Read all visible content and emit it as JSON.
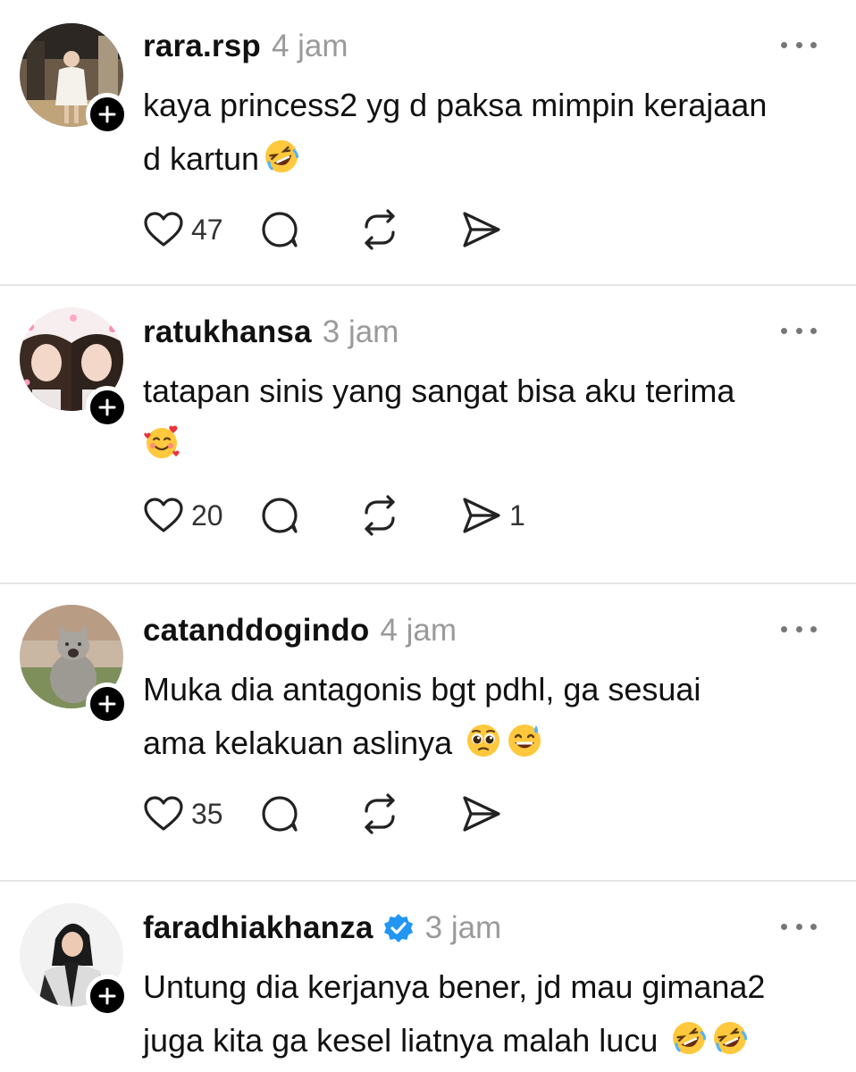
{
  "posts": [
    {
      "username": "rara.rsp",
      "time": "4 jam",
      "text_line1": "kaya princess2 yg d paksa mimpin kerajaan",
      "text_line2": "d kartun",
      "emojis": [
        "rolling-on-floor-laughing"
      ],
      "likes": "47",
      "shares": ""
    },
    {
      "username": "ratukhansa",
      "time": "3 jam",
      "text_line1": "tatapan sinis yang sangat bisa aku terima",
      "text_line2": "",
      "emojis": [
        "smiling-face-with-hearts"
      ],
      "likes": "20",
      "shares": "1"
    },
    {
      "username": "catanddogindo",
      "time": "4 jam",
      "text_line1": "Muka dia antagonis bgt pdhl, ga sesuai",
      "text_line2": "ama kelakuan aslinya ",
      "emojis": [
        "pleading-face",
        "grinning-face-with-sweat"
      ],
      "likes": "35",
      "shares": ""
    },
    {
      "username": "faradhiakhanza",
      "verified": true,
      "time": "3 jam",
      "text_line1": "Untung dia kerjanya bener, jd mau gimana2",
      "text_line2": "juga kita ga kesel liatnya malah lucu ",
      "emojis": [
        "rolling-on-floor-laughing",
        "rolling-on-floor-laughing"
      ],
      "likes": "",
      "shares": ""
    }
  ],
  "colors": {
    "text": "#111111",
    "muted": "#9a9a9a",
    "divider": "#e6e6e6",
    "verified": "#2196f3",
    "emoji_yellow": "#ffc83d"
  }
}
